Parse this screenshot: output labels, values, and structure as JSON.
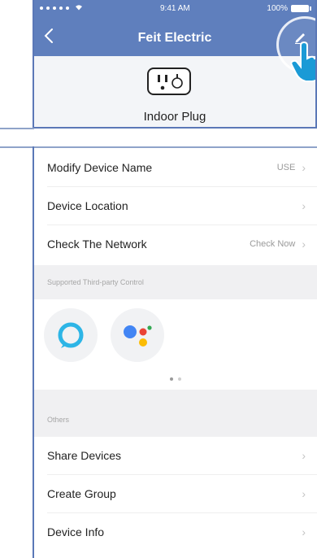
{
  "status_bar": {
    "time": "9:41 AM",
    "battery": "100%"
  },
  "nav": {
    "title": "Feit Electric"
  },
  "device": {
    "name": "Indoor Plug"
  },
  "settings": {
    "modify_name": {
      "label": "Modify Device Name",
      "value": "USE"
    },
    "location": {
      "label": "Device Location"
    },
    "network": {
      "label": "Check The Network",
      "value": "Check Now"
    }
  },
  "third_party": {
    "header": "Supported Third-party Control",
    "services": [
      "alexa-icon",
      "google-assistant-icon"
    ],
    "pager": {
      "pages": 2,
      "active": 1
    }
  },
  "others": {
    "header": "Others",
    "items": [
      {
        "label": "Share Devices"
      },
      {
        "label": "Create Group"
      },
      {
        "label": "Device Info"
      }
    ]
  },
  "colors": {
    "nav_blue": "#5f7fbd",
    "frame_blue": "#5b78b7",
    "alexa": "#2db5e6",
    "google_blue": "#4285f4",
    "google_red": "#ea4335",
    "google_yellow": "#fbbc05",
    "google_green": "#34a853"
  }
}
